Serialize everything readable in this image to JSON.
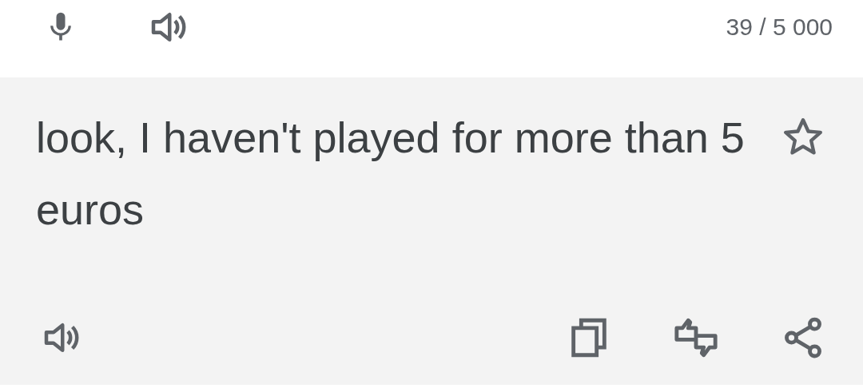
{
  "input_bar": {
    "char_count": "39 / 5 000"
  },
  "translation": {
    "text": "look, I haven't played for more than 5 euros"
  }
}
